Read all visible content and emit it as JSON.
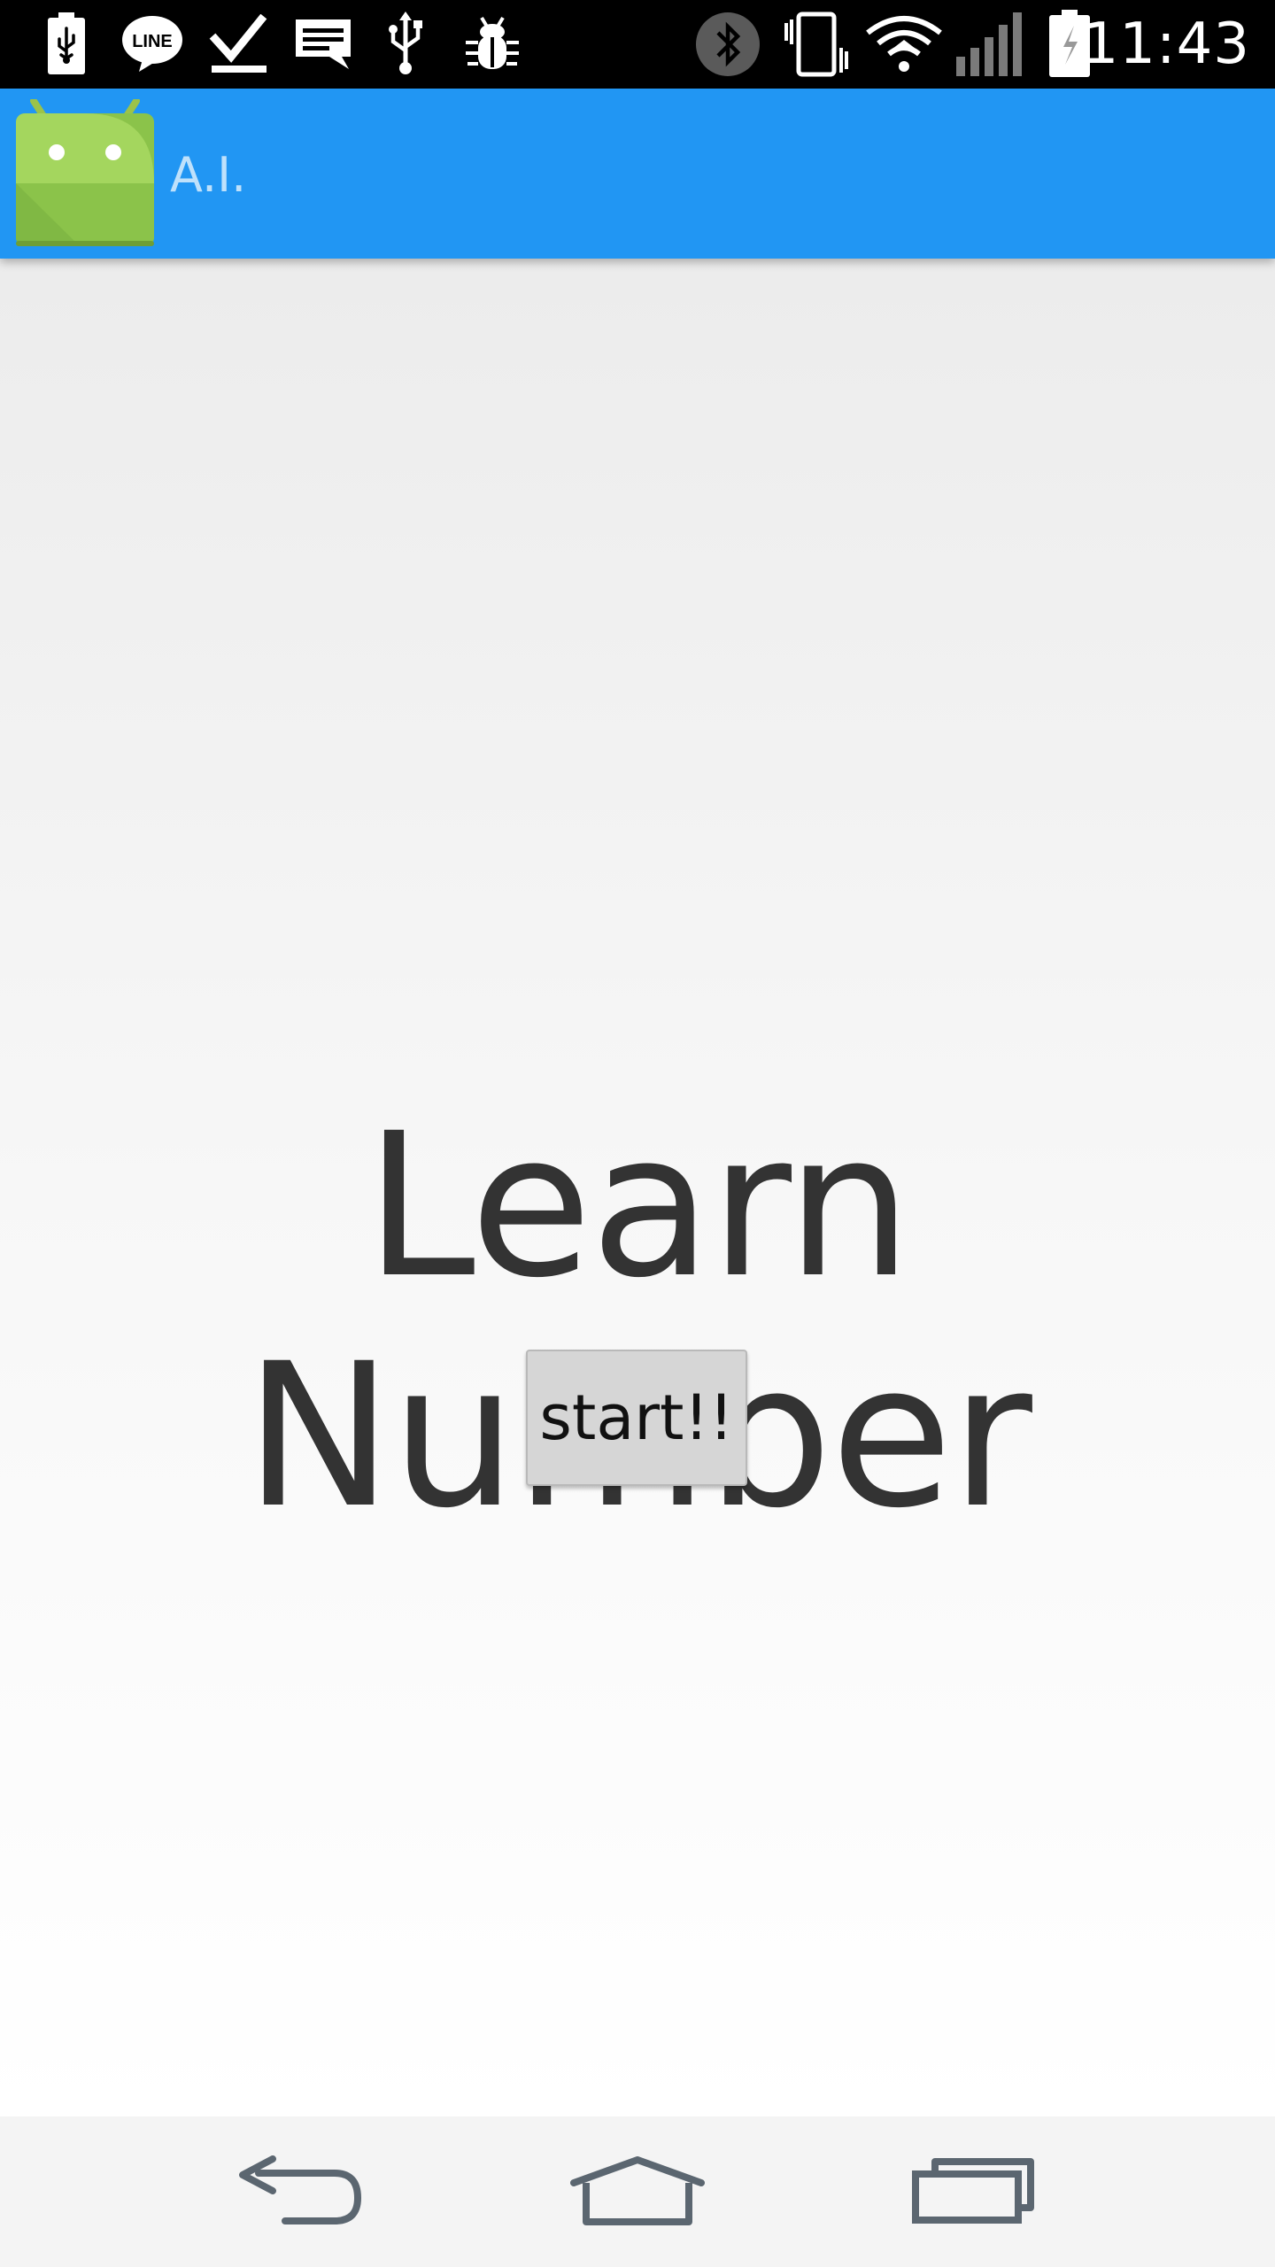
{
  "status_bar": {
    "time": "11:43",
    "notification_icons": [
      "battery-usb-icon",
      "line-app-icon",
      "download-done-icon",
      "message-icon",
      "usb-icon",
      "debug-bug-icon"
    ],
    "system_icons": [
      "bluetooth-icon",
      "vibrate-icon",
      "wifi-icon",
      "signal-icon",
      "battery-charging-icon"
    ],
    "line_badge": "LINE"
  },
  "app_bar": {
    "title": "A.I.",
    "color": "#2196f3",
    "logo_icon": "android-robot-icon"
  },
  "main": {
    "headline": "Learn Number",
    "start_button_label": "start!!"
  },
  "nav_bar": {
    "buttons": [
      "back-icon",
      "home-icon",
      "recent-apps-icon"
    ]
  }
}
